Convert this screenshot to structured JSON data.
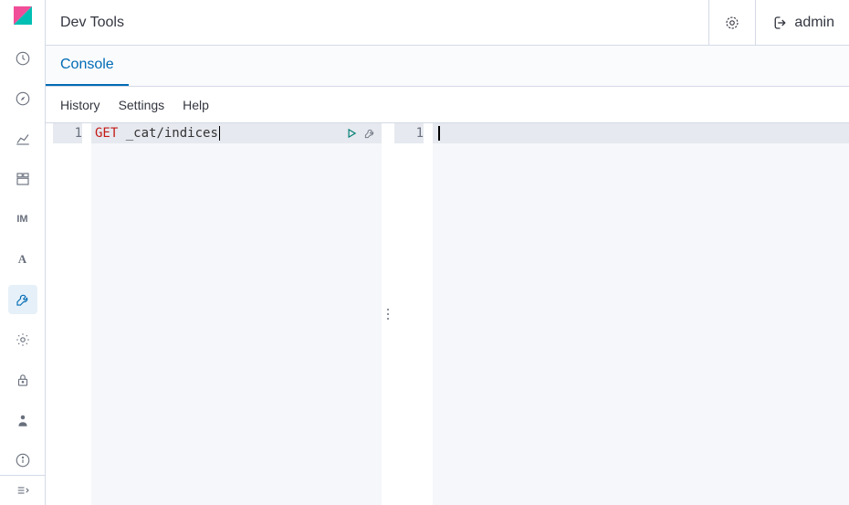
{
  "header": {
    "title": "Dev Tools",
    "user": "admin"
  },
  "tabs": {
    "active": "Console"
  },
  "toolbar": {
    "history": "History",
    "settings": "Settings",
    "help": "Help"
  },
  "editor": {
    "line_number": "1",
    "method": "GET",
    "path": "_cat/indices"
  },
  "output": {
    "line_number": "1"
  },
  "sidebar": {
    "items": [
      {
        "name": "recent",
        "icon": "clock"
      },
      {
        "name": "discover",
        "icon": "compass"
      },
      {
        "name": "visualize",
        "icon": "chart"
      },
      {
        "name": "dashboard",
        "icon": "grid"
      },
      {
        "name": "im",
        "text": "IM"
      },
      {
        "name": "a",
        "text": "A"
      },
      {
        "name": "devtools",
        "icon": "wrench",
        "active": true
      },
      {
        "name": "management",
        "icon": "gear"
      },
      {
        "name": "security",
        "icon": "lock"
      },
      {
        "name": "user",
        "icon": "user-solid"
      },
      {
        "name": "info",
        "icon": "info"
      }
    ]
  }
}
